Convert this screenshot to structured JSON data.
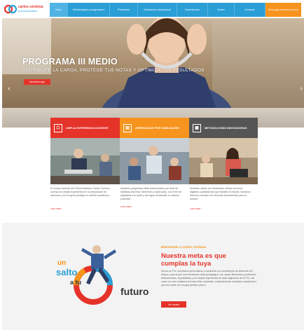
{
  "brand": {
    "line1": "carlos córdova",
    "line2": "preuniversitario"
  },
  "nav": {
    "items": [
      "Inicio",
      "Metodologías y programas ▾",
      "Profesores",
      "Orientación educacional",
      "Experiencias",
      "Sedes",
      "Contacto"
    ],
    "cta": "Descarga nuestro brochure"
  },
  "hero": {
    "title": "PROGRAMA III MEDIO",
    "subtitle": "DISTRIBUYE LA CARGA, PROTEGE TUS NOTAS Y OPTIMIZA TUS RESULTADOS",
    "button": "Inscríbete aquí",
    "prev": "‹",
    "next": "›"
  },
  "features": [
    {
      "title": "AMPLIA EXPERIENCIA DOCENTE",
      "color": "#e5332a",
      "text": "El cuerpo docente del Preuniversitario Carlos Córdova cuenta con amplia experiencia en la preparación de alumnos y con un gran prestigio en ámbito académico.",
      "link": "Leer más  ›"
    },
    {
      "title": "APRENDIZAJE POR HABILIDADES",
      "color": "#f7941d",
      "text": "Nuestros programas están diferenciados por nivel de habilidad (Normal, Intermedio y Avanzado), con el fin de adaptarse a tu perfil y así lograr desarrollar tu máximo potencial.",
      "link": "Leer más  ›"
    },
    {
      "title": "METODOLOGÍAS INNOVADORAS",
      "color": "#555555",
      "text": "Nuestras clases son dinámicas, utilizan recursos digitales y plataformas que facilitan el estudio. Nuestros alumnos cuentan con diversas herramientas para su avance.",
      "link": "Leer más  ›"
    }
  ],
  "welcome": {
    "kicker": "Bienvenido a Carlos Córdova",
    "title_line1": "Nuestra meta es que",
    "title_line2": "cumplas la tuya",
    "text": "Somos un Pre, orientado a personalizar y maximizar a la metodología de desarrollo del alumno, para lo que nos esforzamos tanto pedagógica, con clases dinámicas y profesores seleccionados, especialistas y con amplia experiencia de cada asignatura de la PTU, así como con una confianza en todas ellas, sustentan constantemente resultados académicos, que nos hacen ser el lugar perfecto para ti.",
    "button": "Ver sedes",
    "slogan": {
      "w1": "un",
      "w2": "salto",
      "w3": "a tu",
      "w4": "futuro"
    }
  }
}
